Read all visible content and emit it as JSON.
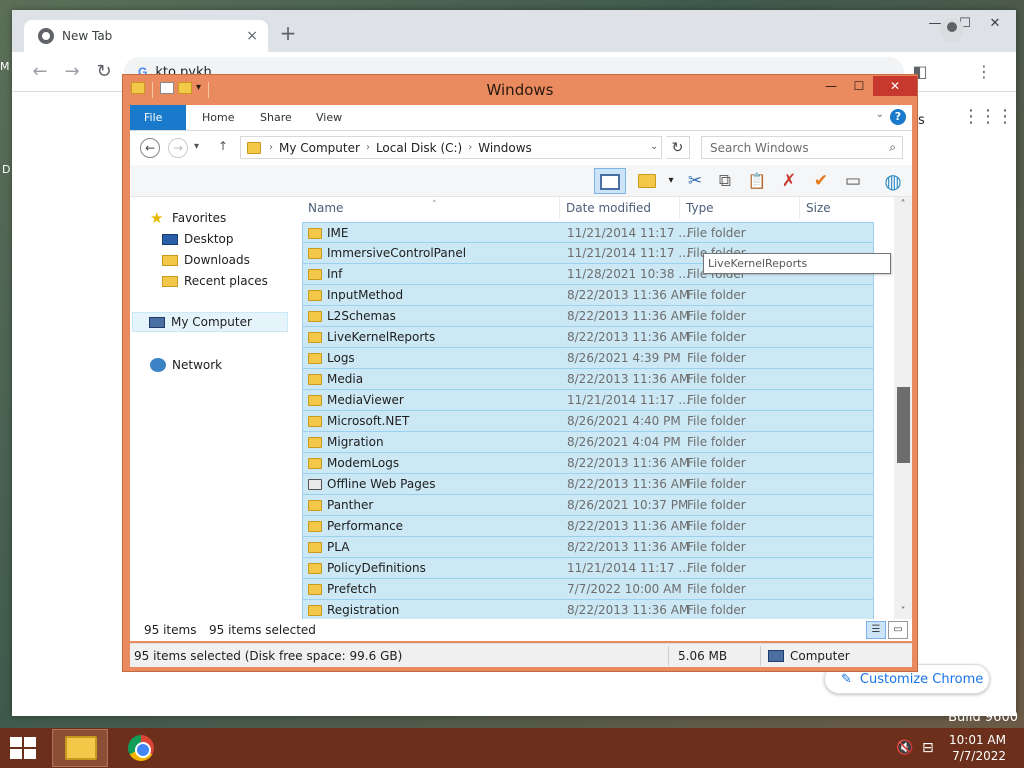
{
  "desktop": {
    "left_edge_top": "M",
    "left_edge_mid": "D",
    "build": "Build 9600"
  },
  "chrome": {
    "tab_title": "New Tab",
    "tab_close": "×",
    "new_tab": "+",
    "omnibox_text": "kto pykh",
    "omnibox_g": "G",
    "ntp_fragment": "es",
    "customize_label": "Customize Chrome",
    "window": {
      "minimize": "—",
      "maximize": "☐",
      "close": "✕"
    }
  },
  "explorer": {
    "title": "Windows",
    "window": {
      "minimize": "—",
      "maximize": "☐",
      "close": "✕"
    },
    "ribbon_tabs": [
      "File",
      "Home",
      "Share",
      "View"
    ],
    "address": {
      "crumbs": [
        "My Computer",
        "Local Disk (C:)",
        "Windows"
      ],
      "separator": "›"
    },
    "search_placeholder": "Search Windows",
    "nav_pane": {
      "favorites": "Favorites",
      "desktop": "Desktop",
      "downloads": "Downloads",
      "recent": "Recent places",
      "computer": "My Computer",
      "network": "Network"
    },
    "columns": {
      "name": "Name",
      "date": "Date modified",
      "type": "Type",
      "size": "Size"
    },
    "rows": [
      {
        "name": "IME",
        "date": "11/21/2014 11:17 ...",
        "type": "File folder"
      },
      {
        "name": "ImmersiveControlPanel",
        "date": "11/21/2014 11:17 ...",
        "type": "File folder"
      },
      {
        "name": "Inf",
        "date": "11/28/2021 10:38 ...",
        "type": "File folder"
      },
      {
        "name": "InputMethod",
        "date": "8/22/2013 11:36 AM",
        "type": "File folder"
      },
      {
        "name": "L2Schemas",
        "date": "8/22/2013 11:36 AM",
        "type": "File folder"
      },
      {
        "name": "LiveKernelReports",
        "date": "8/22/2013 11:36 AM",
        "type": "File folder"
      },
      {
        "name": "Logs",
        "date": "8/26/2021 4:39 PM",
        "type": "File folder"
      },
      {
        "name": "Media",
        "date": "8/22/2013 11:36 AM",
        "type": "File folder"
      },
      {
        "name": "MediaViewer",
        "date": "11/21/2014 11:17 ...",
        "type": "File folder"
      },
      {
        "name": "Microsoft.NET",
        "date": "8/26/2021 4:40 PM",
        "type": "File folder"
      },
      {
        "name": "Migration",
        "date": "8/26/2021 4:04 PM",
        "type": "File folder"
      },
      {
        "name": "ModemLogs",
        "date": "8/22/2013 11:36 AM",
        "type": "File folder"
      },
      {
        "name": "Offline Web Pages",
        "date": "8/22/2013 11:36 AM",
        "type": "File folder"
      },
      {
        "name": "Panther",
        "date": "8/26/2021 10:37 PM",
        "type": "File folder"
      },
      {
        "name": "Performance",
        "date": "8/22/2013 11:36 AM",
        "type": "File folder"
      },
      {
        "name": "PLA",
        "date": "8/22/2013 11:36 AM",
        "type": "File folder"
      },
      {
        "name": "PolicyDefinitions",
        "date": "11/21/2014 11:17 ...",
        "type": "File folder"
      },
      {
        "name": "Prefetch",
        "date": "7/7/2022 10:00 AM",
        "type": "File folder"
      },
      {
        "name": "Registration",
        "date": "8/22/2013 11:36 AM",
        "type": "File folder"
      }
    ],
    "tooltip": "LiveKernelReports",
    "status": {
      "items": "95 items",
      "selected": "95 items selected"
    },
    "details": {
      "summary": "95 items selected (Disk free space: 99.6 GB)",
      "size": "5.06 MB",
      "location": "Computer"
    }
  },
  "taskbar": {
    "time": "10:01 AM",
    "date": "7/7/2022"
  },
  "icons": {
    "back": "←",
    "forward": "→",
    "reload": "↻",
    "up": "↑",
    "down_caret": "▾",
    "search": "⌕",
    "refresh": "↻",
    "help": "?",
    "chevron_down": "⌄",
    "cut": "✂",
    "copy": "⧉",
    "paste": "📋",
    "delete": "✗",
    "check": "✔",
    "rename": "▭",
    "globe": "◍",
    "speaker_muted": "🔇",
    "network": "⊟",
    "kebab": "⋮",
    "apps": "⋮⋮⋮",
    "pencil": "✎",
    "star": "★",
    "side_panel": "◧"
  },
  "colors": {
    "explorer_frame": "#e98a5f",
    "selection": "#cce8f5",
    "taskbar": "#6b2f1b",
    "accent": "#1979ca"
  }
}
